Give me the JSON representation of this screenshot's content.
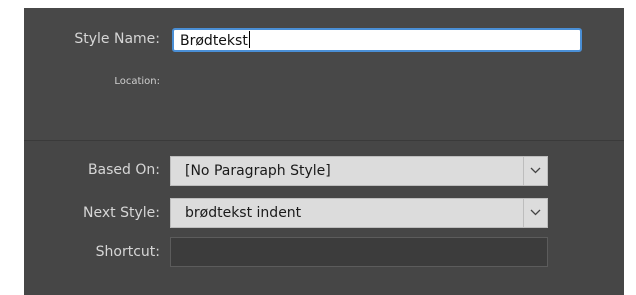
{
  "style_name": {
    "label": "Style Name:",
    "value": "Brødtekst"
  },
  "location": {
    "label": "Location:",
    "value": ""
  },
  "based_on": {
    "label": "Based On:",
    "selected": "[No Paragraph Style]"
  },
  "next_style": {
    "label": "Next Style:",
    "selected": "brødtekst indent"
  },
  "shortcut": {
    "label": "Shortcut:",
    "value": ""
  },
  "icons": {
    "dropdown": "chevron-down-icon"
  },
  "colors": {
    "panel": "#464646",
    "focus_border": "#4a8fd6",
    "select_bg": "#dcdcdc"
  }
}
